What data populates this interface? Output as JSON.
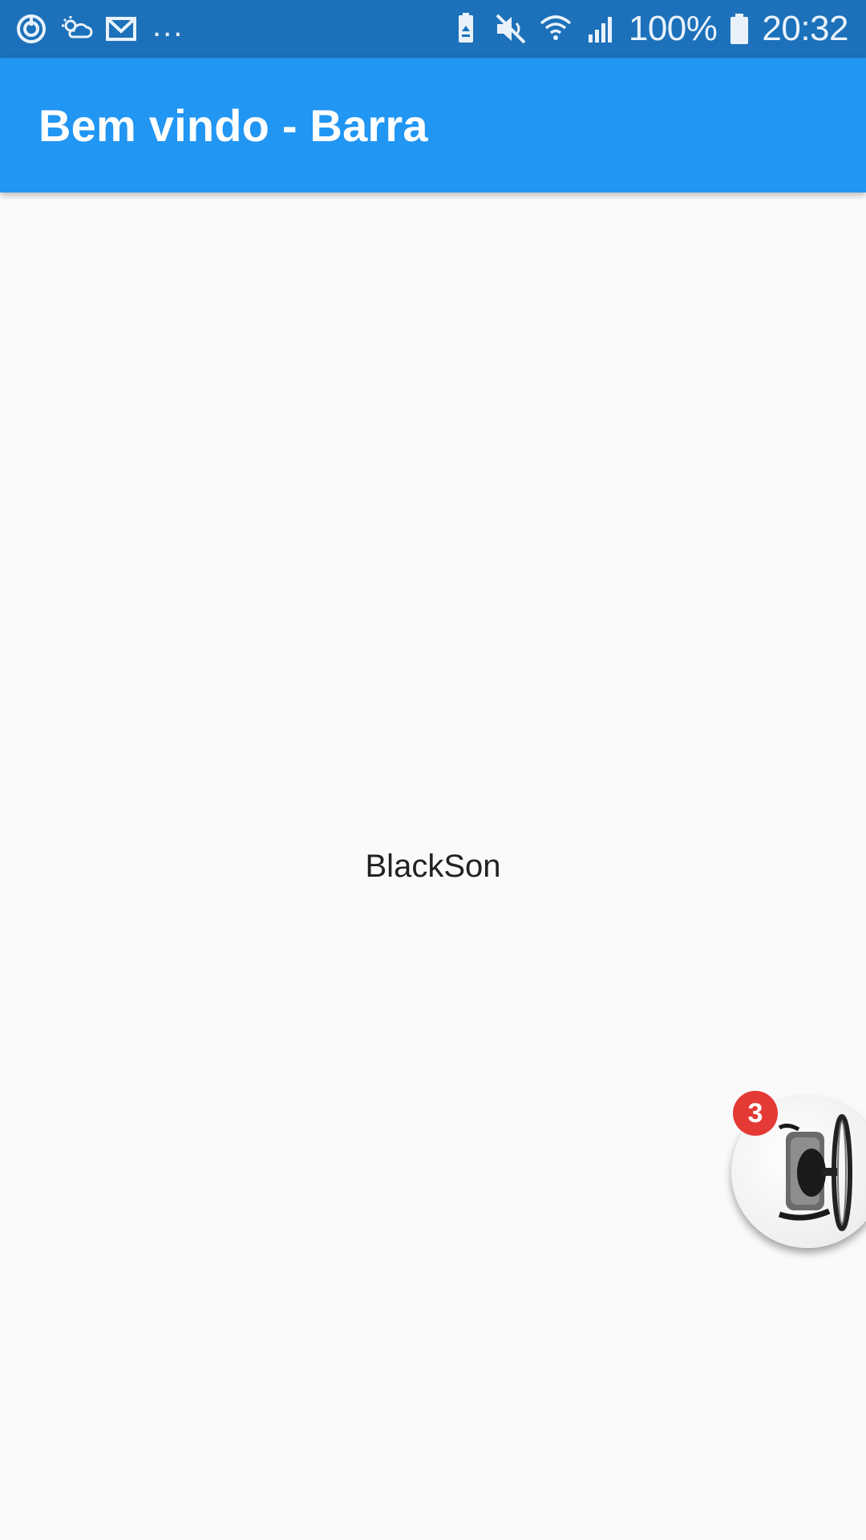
{
  "status_bar": {
    "left_icons": [
      "data-saver-icon",
      "weather-icon",
      "gmail-icon"
    ],
    "more_indicator": "...",
    "right_icons": [
      "battery-saver-icon",
      "mute-icon",
      "wifi-icon",
      "signal-icon",
      "battery-icon"
    ],
    "battery_percent": "100%",
    "time": "20:32",
    "background_color": "#1c71ba"
  },
  "app_bar": {
    "title": "Bem vindo - Barra",
    "background_color": "#2196f3"
  },
  "main": {
    "center_text": "BlackSon"
  },
  "chat_head": {
    "badge_count": "3",
    "badge_color": "#e53935",
    "image_icon": "product-image-icon"
  }
}
